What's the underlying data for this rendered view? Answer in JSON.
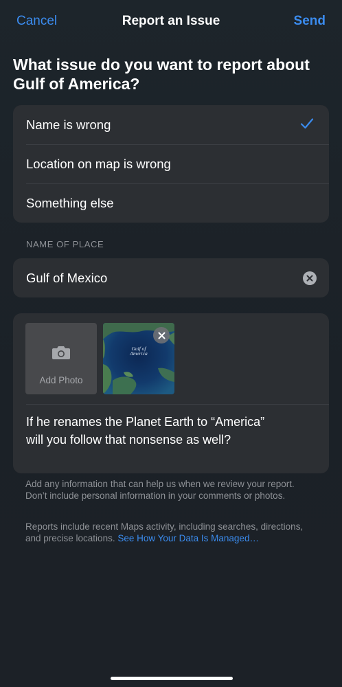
{
  "nav": {
    "cancel_label": "Cancel",
    "title": "Report an Issue",
    "send_label": "Send"
  },
  "question": {
    "line1": "What issue do you want to report about",
    "line2": "Gulf of America?"
  },
  "options": [
    {
      "label": "Name is wrong",
      "selected": true
    },
    {
      "label": "Location on map is wrong",
      "selected": false
    },
    {
      "label": "Something else",
      "selected": false
    }
  ],
  "name_section": {
    "header": "NAME OF PLACE",
    "value": "Gulf of Mexico"
  },
  "photos": {
    "add_label": "Add Photo",
    "thumbnail_caption": "Gulf of America"
  },
  "comment": {
    "line1": "If he renames the Planet Earth to “America”",
    "line2": "will you follow that nonsense as well?"
  },
  "footer": {
    "info_text": "Add any information that can help us when we review your report. Don’t include personal information in your comments or photos.",
    "privacy_text": "Reports include recent Maps activity, including searches, directions, and precise locations. ",
    "privacy_link": "See How Your Data Is Managed…"
  },
  "colors": {
    "accent": "#3b8cef",
    "background": "#1d252b",
    "card": "#2c2f33",
    "secondary_text": "#8e9196"
  }
}
